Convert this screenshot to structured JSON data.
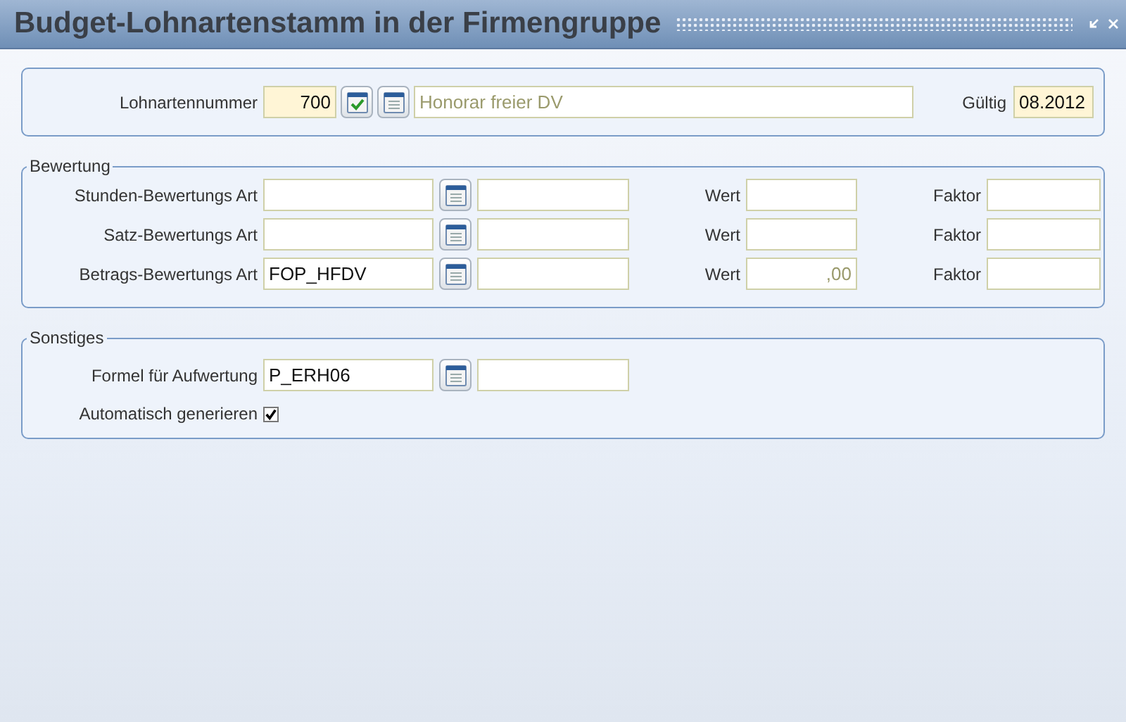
{
  "window": {
    "title": "Budget-Lohnartenstamm in der Firmengruppe"
  },
  "header": {
    "label": "Lohnartennummer",
    "number": {
      "value": "700",
      "readonly": false
    },
    "description": {
      "value": "Honorar freier DV",
      "readonly": true
    },
    "valid_label": "Gültig",
    "valid": {
      "value": "08.2012",
      "readonly": false
    }
  },
  "bewertung": {
    "legend": "Bewertung",
    "rows": [
      {
        "label": "Stunden-Bewertungs Art",
        "wert_label": "Wert",
        "faktor_label": "Faktor"
      },
      {
        "label": "Satz-Bewertungs Art",
        "wert_label": "Wert",
        "faktor_label": "Faktor"
      },
      {
        "label": "Betrags-Bewertungs Art",
        "code": {
          "value": "FOP_HFDV",
          "readonly": false
        },
        "wert_label": "Wert",
        "wert": {
          "value": ",00",
          "readonly": true
        },
        "faktor_label": "Faktor"
      }
    ]
  },
  "sonstiges": {
    "legend": "Sonstiges",
    "formula_label": "Formel für Aufwertung",
    "formula": {
      "value": "P_ERH06",
      "readonly": false
    },
    "auto_label": "Automatisch generieren",
    "auto_checked": true
  }
}
